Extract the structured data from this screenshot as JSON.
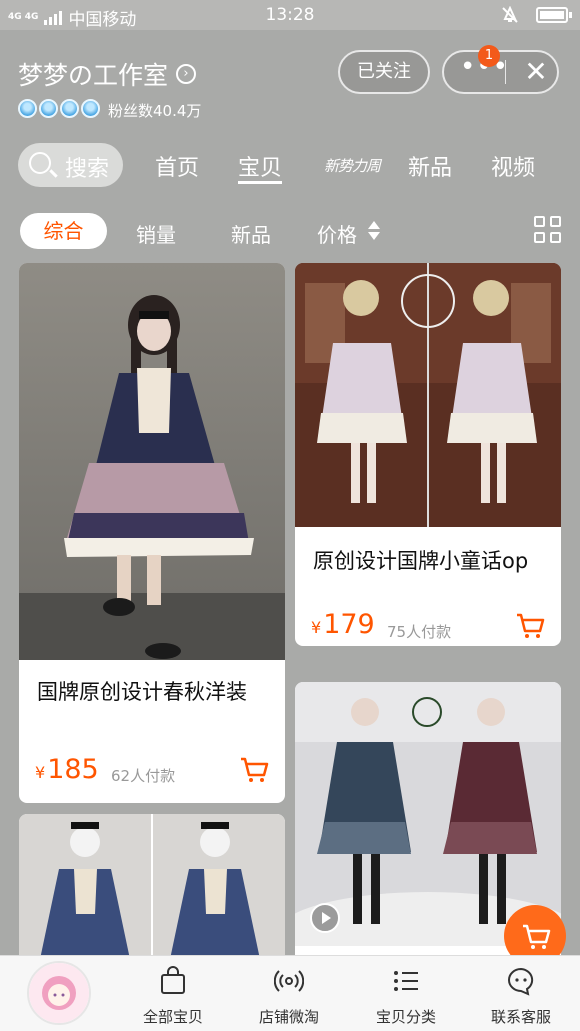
{
  "status_bar": {
    "signal_label": "4G 4G",
    "carrier": "中国移动",
    "time": "13:28"
  },
  "header": {
    "shop_name": "梦梦の工作室",
    "fans": "粉丝数40.4万",
    "follow_button": "已关注",
    "notification_count": "1"
  },
  "nav": {
    "search_label": "搜索",
    "tabs": [
      {
        "label": "首页",
        "active": false
      },
      {
        "label": "宝贝",
        "active": true
      },
      {
        "label": "新势力周",
        "active": false
      },
      {
        "label": "新品",
        "active": false
      },
      {
        "label": "视频",
        "active": false
      }
    ]
  },
  "sort": {
    "items": [
      {
        "label": "综合",
        "active": true
      },
      {
        "label": "销量",
        "active": false
      },
      {
        "label": "新品",
        "active": false
      },
      {
        "label": "价格",
        "active": false
      }
    ]
  },
  "products": [
    {
      "title": "国牌原创设计春秋洋装",
      "price": "185",
      "currency": "¥",
      "paid": "62人付款"
    },
    {
      "title": "原创设计国牌小童话op",
      "price": "179",
      "currency": "¥",
      "paid": "75人付款"
    },
    {
      "title": "",
      "price": "",
      "currency": "",
      "paid": ""
    },
    {
      "title": "",
      "price": "",
      "currency": "",
      "paid": ""
    }
  ],
  "bottom_bar": {
    "items": [
      {
        "label": "全部宝贝",
        "icon": "shopping-bag-icon"
      },
      {
        "label": "店铺微淘",
        "icon": "broadcast-icon"
      },
      {
        "label": "宝贝分类",
        "icon": "list-icon"
      },
      {
        "label": "联系客服",
        "icon": "chat-icon"
      }
    ]
  },
  "colors": {
    "accent": "#ff5500",
    "header_bg": "#a9aaa8"
  }
}
